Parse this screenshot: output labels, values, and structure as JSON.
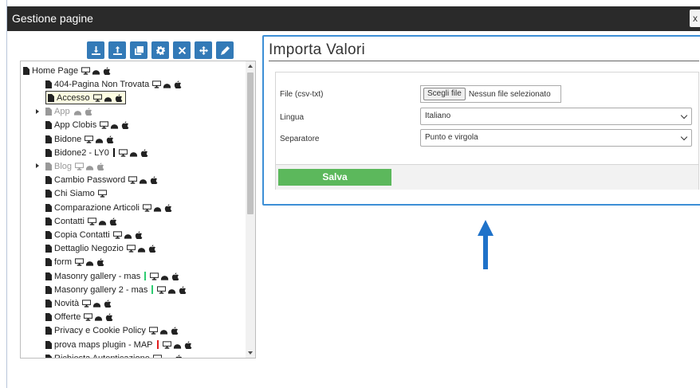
{
  "dialog": {
    "title": "Gestione pagine",
    "close_label": "x"
  },
  "toolbar": {
    "buttons": [
      {
        "name": "download-icon"
      },
      {
        "name": "upload-icon"
      },
      {
        "name": "copy-icon"
      },
      {
        "name": "gear-icon"
      },
      {
        "name": "close-icon"
      },
      {
        "name": "move-icon"
      },
      {
        "name": "pencil-icon"
      }
    ]
  },
  "tree": {
    "items": [
      {
        "label": "Home Page",
        "devices": [
          "desktop",
          "android",
          "apple"
        ]
      },
      {
        "label": "404-Pagina Non Trovata",
        "devices": [
          "desktop",
          "android",
          "apple"
        ]
      },
      {
        "label": "Accesso",
        "devices": [
          "desktop",
          "android",
          "apple"
        ],
        "selected": true
      },
      {
        "label": "App",
        "devices": [
          "android",
          "apple"
        ],
        "expandable": true,
        "dim": true
      },
      {
        "label": "App Clobis",
        "devices": [
          "desktop",
          "android",
          "apple"
        ]
      },
      {
        "label": "Bidone",
        "devices": [
          "desktop",
          "android",
          "apple"
        ]
      },
      {
        "label": "Bidone2 - LY0",
        "devices": [
          "desktop",
          "android",
          "apple"
        ],
        "bar": "#111111"
      },
      {
        "label": "Blog",
        "devices": [
          "desktop",
          "android",
          "apple"
        ],
        "expandable": true,
        "dim": true
      },
      {
        "label": "Cambio Password",
        "devices": [
          "desktop",
          "android",
          "apple"
        ]
      },
      {
        "label": "Chi Siamo",
        "devices": [
          "desktop"
        ]
      },
      {
        "label": "Comparazione Articoli",
        "devices": [
          "desktop",
          "android",
          "apple"
        ]
      },
      {
        "label": "Contatti",
        "devices": [
          "desktop",
          "android",
          "apple"
        ]
      },
      {
        "label": "Copia Contatti",
        "devices": [
          "desktop",
          "android",
          "apple"
        ]
      },
      {
        "label": "Dettaglio Negozio",
        "devices": [
          "desktop",
          "android",
          "apple"
        ]
      },
      {
        "label": "form",
        "devices": [
          "desktop",
          "android",
          "apple"
        ]
      },
      {
        "label": "Masonry gallery - mas",
        "devices": [
          "desktop",
          "android",
          "apple"
        ],
        "bar": "#2ecc71"
      },
      {
        "label": "Masonry gallery 2 - mas",
        "devices": [
          "desktop",
          "android",
          "apple"
        ],
        "bar": "#2ecc71"
      },
      {
        "label": "Novità",
        "devices": [
          "desktop",
          "android",
          "apple"
        ]
      },
      {
        "label": "Offerte",
        "devices": [
          "desktop",
          "android",
          "apple"
        ]
      },
      {
        "label": "Privacy e Cookie Policy",
        "devices": [
          "desktop",
          "android",
          "apple"
        ]
      },
      {
        "label": "prova maps plugin - MAP",
        "devices": [
          "desktop",
          "android",
          "apple"
        ],
        "bar": "#e02020"
      },
      {
        "label": "Richiesta Autenticazione",
        "devices": [
          "desktop",
          "android",
          "apple"
        ]
      }
    ]
  },
  "panel": {
    "title": "Importa Valori",
    "file_label": "File (csv-txt)",
    "file_button": "Scegli file",
    "file_status": "Nessun file selezionato",
    "language_label": "Lingua",
    "language_value": "Italiano",
    "separator_label": "Separatore",
    "separator_value": "Punto e virgola",
    "save_label": "Salva"
  },
  "colors": {
    "titlebar": "#2a2a2a",
    "toolbar_button": "#337ab7",
    "panel_border": "#3d8fd6",
    "save_button": "#5cb85c",
    "arrow": "#1f72c9"
  }
}
